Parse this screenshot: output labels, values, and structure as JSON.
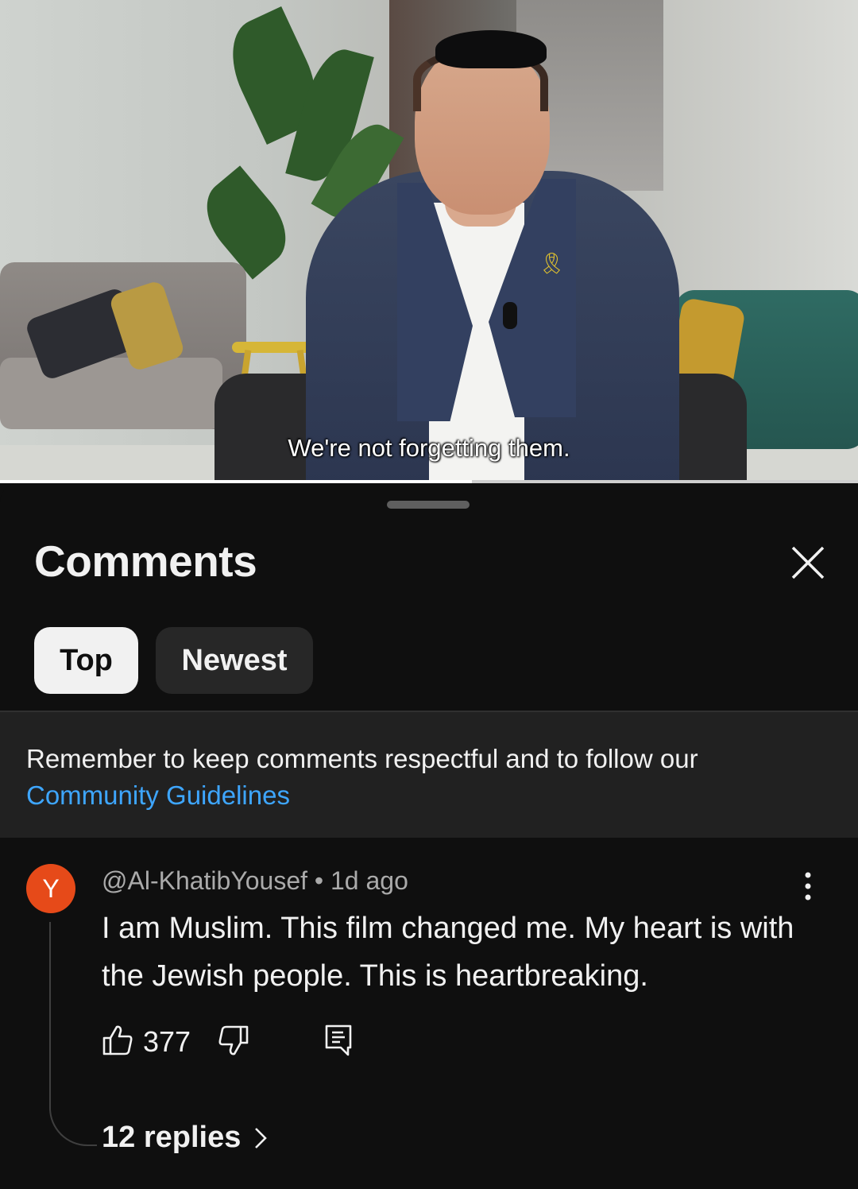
{
  "video": {
    "subtitle": "We're not forgetting them.",
    "progress_fraction": 0.55
  },
  "comments_sheet": {
    "title": "Comments",
    "close_icon": "close-icon",
    "sort_chips": [
      {
        "label": "Top",
        "selected": true
      },
      {
        "label": "Newest",
        "selected": false
      }
    ],
    "notice": {
      "text": "Remember to keep comments respectful and to follow our ",
      "link": "Community Guidelines"
    },
    "comments": [
      {
        "avatar_letter": "Y",
        "avatar_color": "#e64a19",
        "author": "@Al-KhatibYousef",
        "separator": "•",
        "time": "1d ago",
        "text": "I am Muslim. This film changed me. My heart is with the Jewish people. This is heartbreaking.",
        "likes": "377",
        "replies_label": "12 replies"
      }
    ]
  },
  "colors": {
    "background": "#0f0f0f",
    "link": "#3ea6ff",
    "notice_bg": "#212121",
    "chip_selected_bg": "#f1f1f1",
    "chip_bg": "#272727"
  }
}
